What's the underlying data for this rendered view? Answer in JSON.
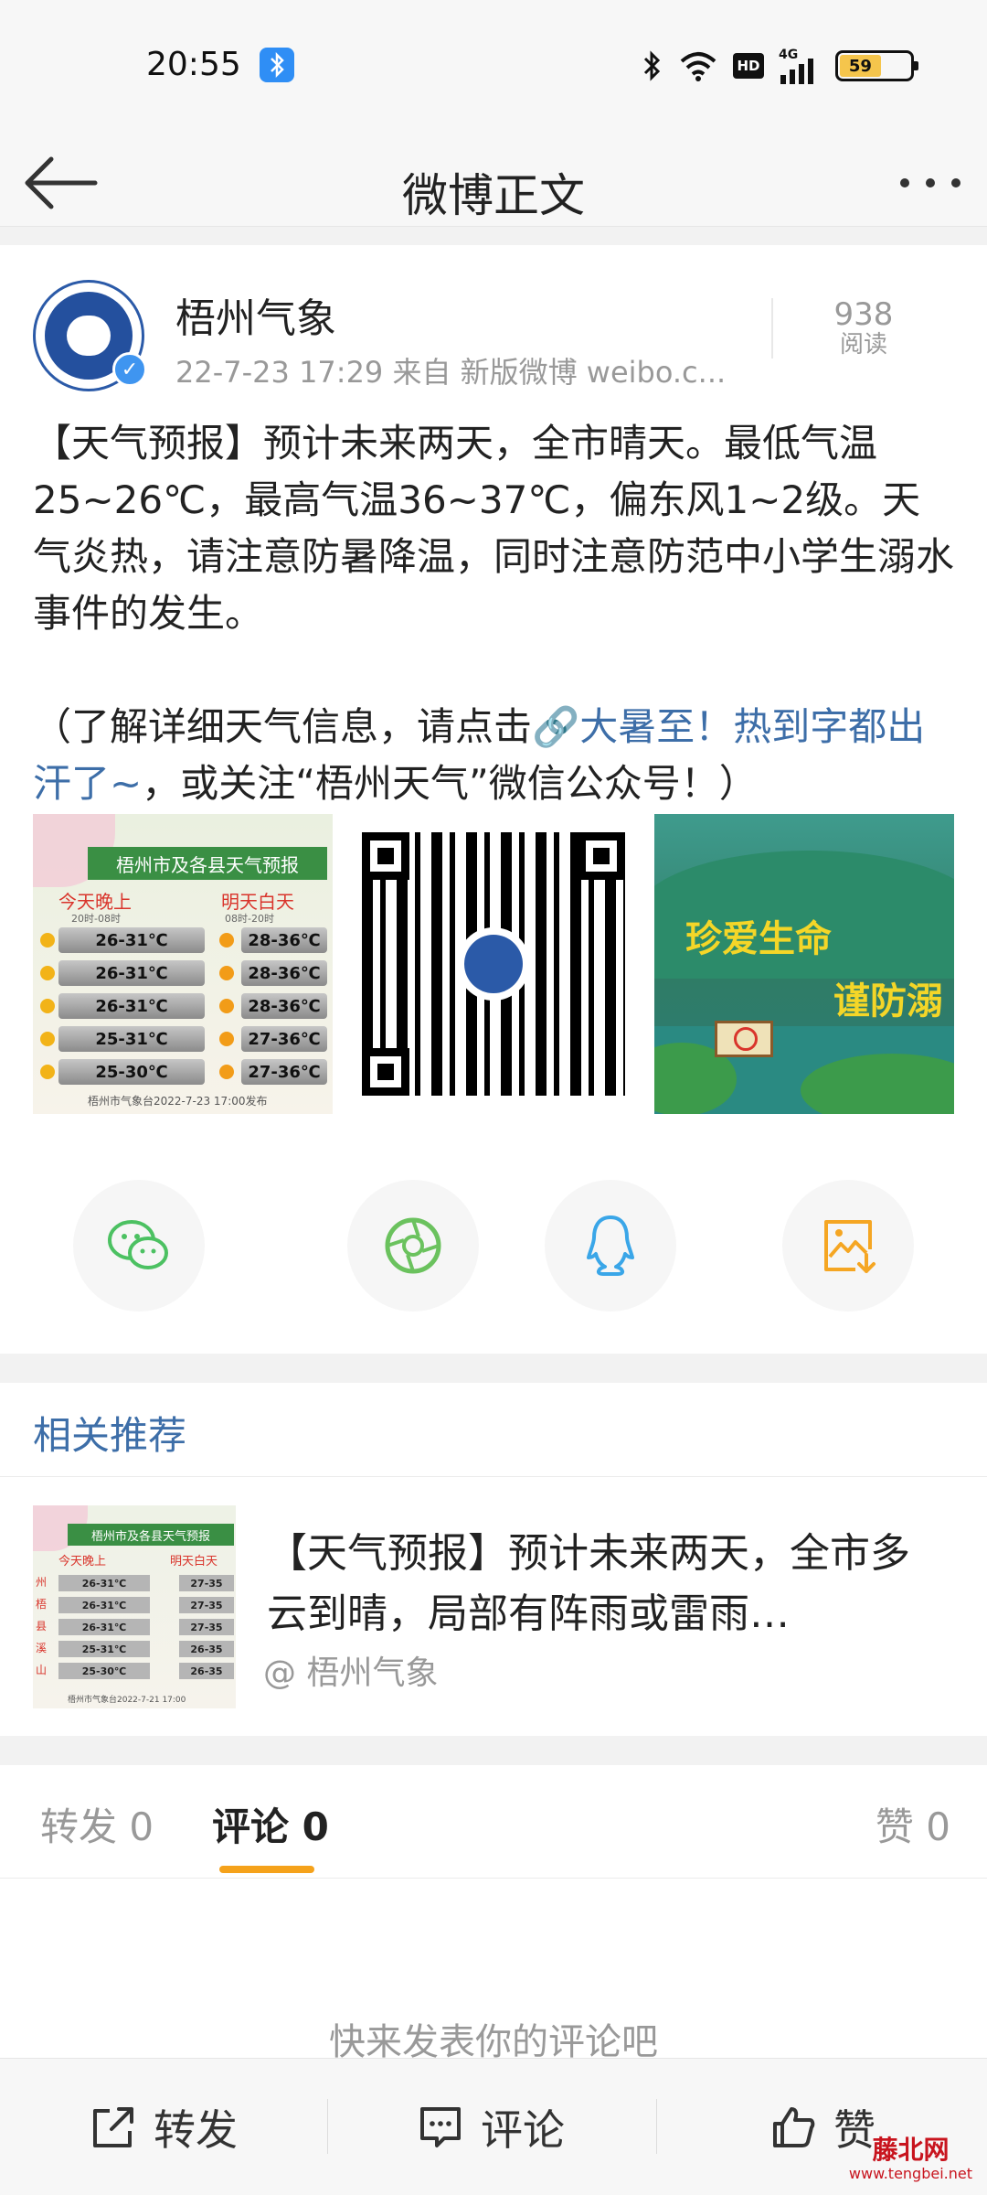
{
  "status_bar": {
    "time": "20:55",
    "network": "4G",
    "hd": "HD",
    "battery": "59"
  },
  "header": {
    "title": "微博正文"
  },
  "post": {
    "author": "梧州气象",
    "meta": "22-7-23 17:29  来自 新版微博 weibo.c...",
    "read_count": "938",
    "read_label": "阅读",
    "paragraph1": "【天气预报】预计未来两天，全市晴天。最低气温25~26℃，最高气温36~37℃，偏东风1~2级。天气炎热，请注意防暑降温，同时注意防范中小学生溺水事件的发生。",
    "paragraph2_prefix": "（了解详细天气信息，请点击",
    "link_text": "🔗大暑至！热到字都出汗了~",
    "paragraph2_suffix": "，或关注“梧州天气”微信公众号！）",
    "images": {
      "weather": {
        "header": "梧州市及各县天气预报",
        "col_left": "今天晚上",
        "col_left_sub": "20时-08时",
        "col_right": "明天白天",
        "col_right_sub": "08时-20时",
        "rows": [
          {
            "night": "26-31℃",
            "day": "28-36℃"
          },
          {
            "night": "26-31℃",
            "day": "28-36℃"
          },
          {
            "night": "26-31℃",
            "day": "28-36℃"
          },
          {
            "night": "25-31℃",
            "day": "27-36℃"
          },
          {
            "night": "25-30℃",
            "day": "27-36℃"
          }
        ],
        "footer": "梧州市气象台2022-7-23  17:00发布"
      },
      "swim": {
        "line1": "珍爱生命",
        "line2": "谨防溺"
      }
    }
  },
  "share_icons": [
    "wechat-icon",
    "moments-icon",
    "qq-icon",
    "save-image-icon"
  ],
  "recommend": {
    "title": "相关推荐",
    "item": {
      "text": "【天气预报】预计未来两天，全市多云到晴，局部有阵雨或雷雨…",
      "source": "@ 梧州气象",
      "thumb": {
        "header": "梧州市及各县天气预报",
        "col_left": "今天晚上",
        "col_right": "明天白天",
        "side": [
          "州",
          "梧",
          "县",
          "溪",
          "山"
        ],
        "rows": [
          {
            "night": "26-31℃",
            "day": "27-35"
          },
          {
            "night": "26-31℃",
            "day": "27-35"
          },
          {
            "night": "26-31℃",
            "day": "27-35"
          },
          {
            "night": "25-31℃",
            "day": "26-35"
          },
          {
            "night": "25-30℃",
            "day": "26-35"
          }
        ],
        "footer": "梧州市气象台2022-7-21  17:00"
      }
    }
  },
  "tabs": {
    "repost": "转发 0",
    "comment": "评论 0",
    "like": "赞 0"
  },
  "empty_comment": "快来发表你的评论吧",
  "bottom_bar": {
    "repost": "转发",
    "comment": "评论",
    "like": "赞"
  },
  "watermark": {
    "top": "藤北网",
    "bottom": "www.tengbei.net"
  },
  "colors": {
    "link": "#3d6ea8",
    "tab_indicator": "#f5a21b",
    "wechat": "#4cc162",
    "moments": "#6bc25e",
    "qq": "#3aa6e8",
    "save": "#f5a623"
  }
}
